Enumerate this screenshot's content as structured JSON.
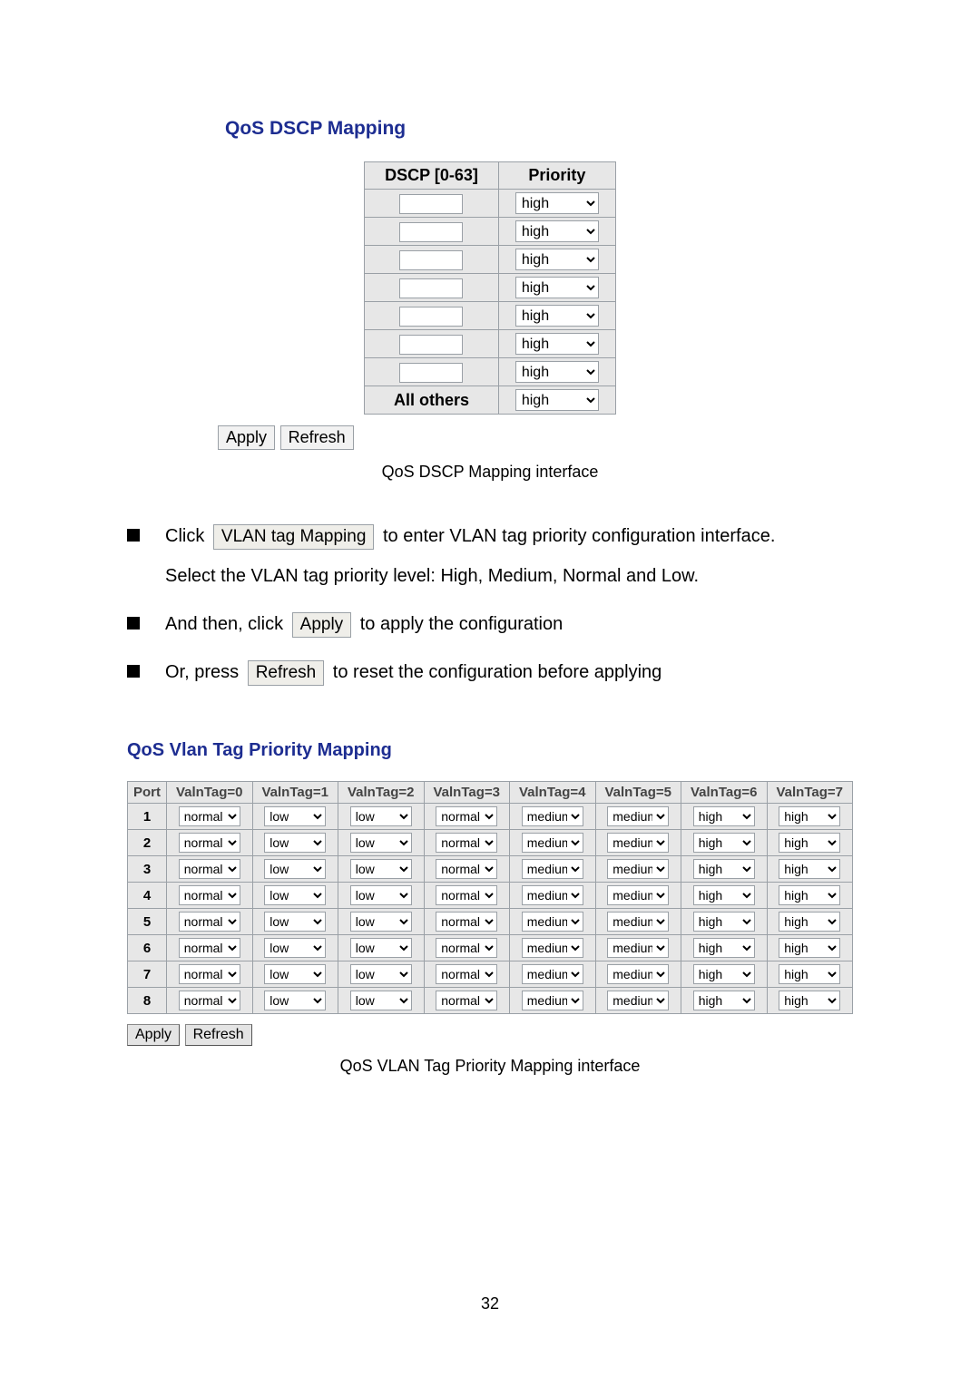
{
  "dscp": {
    "title": "QoS DSCP Mapping",
    "col1": "DSCP [0-63]",
    "col2": "Priority",
    "rows": [
      {
        "input": "",
        "priority": "high"
      },
      {
        "input": "",
        "priority": "high"
      },
      {
        "input": "",
        "priority": "high"
      },
      {
        "input": "",
        "priority": "high"
      },
      {
        "input": "",
        "priority": "high"
      },
      {
        "input": "",
        "priority": "high"
      },
      {
        "input": "",
        "priority": "high"
      }
    ],
    "allothers_label": "All others",
    "allothers_priority": "high",
    "apply": "Apply",
    "refresh": "Refresh",
    "caption": "QoS DSCP Mapping interface"
  },
  "instr": {
    "i1_a": "Click",
    "i1_btn": "VLAN tag Mapping",
    "i1_b": "to enter VLAN tag priority configuration interface.",
    "i1_c": "Select the VLAN tag priority level: High, Medium, Normal and Low.",
    "i2_a": "And then, click",
    "i2_btn": "Apply",
    "i2_b": "to apply the configuration",
    "i3_a": "Or, press",
    "i3_btn": "Refresh",
    "i3_b": "to reset the configuration before applying"
  },
  "vlan": {
    "title": "QoS Vlan Tag Priority Mapping",
    "headers": [
      "Port",
      "ValnTag=0",
      "ValnTag=1",
      "ValnTag=2",
      "ValnTag=3",
      "ValnTag=4",
      "ValnTag=5",
      "ValnTag=6",
      "ValnTag=7"
    ],
    "rows": [
      {
        "port": "1",
        "v": [
          "normal",
          "low",
          "low",
          "normal",
          "medium",
          "medium",
          "high",
          "high"
        ]
      },
      {
        "port": "2",
        "v": [
          "normal",
          "low",
          "low",
          "normal",
          "medium",
          "medium",
          "high",
          "high"
        ]
      },
      {
        "port": "3",
        "v": [
          "normal",
          "low",
          "low",
          "normal",
          "medium",
          "medium",
          "high",
          "high"
        ]
      },
      {
        "port": "4",
        "v": [
          "normal",
          "low",
          "low",
          "normal",
          "medium",
          "medium",
          "high",
          "high"
        ]
      },
      {
        "port": "5",
        "v": [
          "normal",
          "low",
          "low",
          "normal",
          "medium",
          "medium",
          "high",
          "high"
        ]
      },
      {
        "port": "6",
        "v": [
          "normal",
          "low",
          "low",
          "normal",
          "medium",
          "medium",
          "high",
          "high"
        ]
      },
      {
        "port": "7",
        "v": [
          "normal",
          "low",
          "low",
          "normal",
          "medium",
          "medium",
          "high",
          "high"
        ]
      },
      {
        "port": "8",
        "v": [
          "normal",
          "low",
          "low",
          "normal",
          "medium",
          "medium",
          "high",
          "high"
        ]
      }
    ],
    "apply": "Apply",
    "refresh": "Refresh",
    "caption": "QoS VLAN Tag Priority Mapping interface"
  },
  "pagenum": "32"
}
